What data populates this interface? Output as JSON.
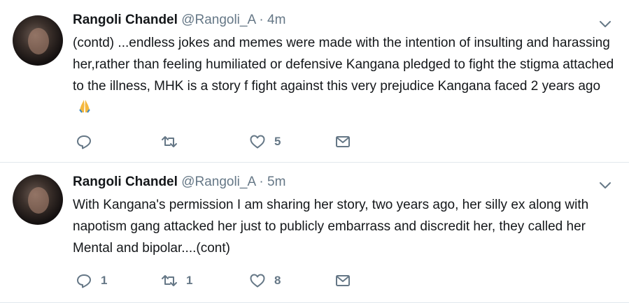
{
  "tweets": [
    {
      "name": "Rangoli Chandel",
      "handle": "@Rangoli_A",
      "separator": "·",
      "time": "4m",
      "text": "(contd) ...endless jokes and memes were made with the intention of insulting and harassing her,rather than feeling humiliated or defensive Kangana pledged to fight the stigma attached to the illness, MHK is a story f fight against this very prejudice Kangana faced 2 years ago",
      "emoji": "folded-hands-emoji",
      "reply_count": "",
      "retweet_count": "",
      "like_count": "5"
    },
    {
      "name": "Rangoli Chandel",
      "handle": "@Rangoli_A",
      "separator": "·",
      "time": "5m",
      "text": "With Kangana's permission I am sharing her story, two years ago, her silly ex along with napotism gang attacked her just to publicly embarrass and discredit her, they called her Mental and bipolar....(cont)",
      "reply_count": "1",
      "retweet_count": "1",
      "like_count": "8"
    }
  ],
  "icons": {
    "reply": "reply-icon",
    "retweet": "retweet-icon",
    "like": "heart-icon",
    "dm": "envelope-icon",
    "menu": "chevron-down-icon"
  },
  "colors": {
    "text": "#14171a",
    "muted": "#657786",
    "divider": "#e1e8ed"
  }
}
